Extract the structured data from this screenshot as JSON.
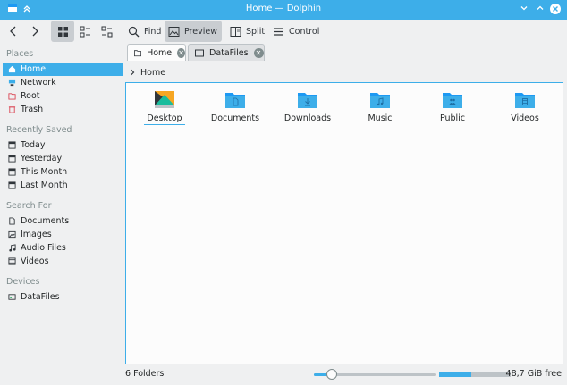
{
  "window": {
    "title": "Home — Dolphin"
  },
  "toolbar": {
    "find_label": "Find",
    "preview_label": "Preview",
    "split_label": "Split",
    "control_label": "Control"
  },
  "sidebar": {
    "sections": [
      {
        "title": "Places",
        "items": [
          {
            "label": "Home",
            "selected": true,
            "icon": "home-icon"
          },
          {
            "label": "Network",
            "icon": "network-icon"
          },
          {
            "label": "Root",
            "icon": "root-folder-icon"
          },
          {
            "label": "Trash",
            "icon": "trash-icon"
          }
        ]
      },
      {
        "title": "Recently Saved",
        "items": [
          {
            "label": "Today",
            "icon": "calendar-icon"
          },
          {
            "label": "Yesterday",
            "icon": "calendar-icon"
          },
          {
            "label": "This Month",
            "icon": "calendar-icon"
          },
          {
            "label": "Last Month",
            "icon": "calendar-icon"
          }
        ]
      },
      {
        "title": "Search For",
        "items": [
          {
            "label": "Documents",
            "icon": "documents-icon"
          },
          {
            "label": "Images",
            "icon": "images-icon"
          },
          {
            "label": "Audio Files",
            "icon": "audio-icon"
          },
          {
            "label": "Videos",
            "icon": "videos-icon"
          }
        ]
      },
      {
        "title": "Devices",
        "items": [
          {
            "label": "DataFiles",
            "icon": "drive-icon"
          }
        ]
      }
    ]
  },
  "tabs": [
    {
      "label": "Home",
      "active": true
    },
    {
      "label": "DataFiles",
      "active": false
    }
  ],
  "breadcrumb": {
    "label": "Home"
  },
  "files": [
    {
      "label": "Desktop",
      "icon": "desktop-folder-icon",
      "selected": true
    },
    {
      "label": "Documents",
      "icon": "documents-folder-icon"
    },
    {
      "label": "Downloads",
      "icon": "downloads-folder-icon"
    },
    {
      "label": "Music",
      "icon": "music-folder-icon"
    },
    {
      "label": "Public",
      "icon": "public-folder-icon"
    },
    {
      "label": "Videos",
      "icon": "videos-folder-icon"
    }
  ],
  "status": {
    "count_text": "6 Folders",
    "free_text": "48,7 GiB free",
    "zoom_fraction": 0.15,
    "used_fraction": 0.45
  },
  "colors": {
    "accent": "#3daee9",
    "folder": "#3daee9",
    "trash": "#da4453"
  }
}
